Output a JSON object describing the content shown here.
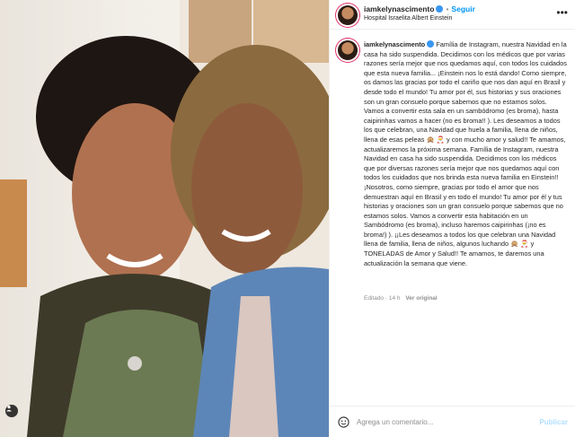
{
  "post": {
    "username": "iamkelynascimento",
    "follow_label": "Seguir",
    "separator": "•",
    "location": "Hospital Israelita Albert Einstein",
    "caption": "Família de Instagram, nuestra Navidad en la casa ha sido suspendida. Decidimos con los médicos que por varias razones sería mejor que nos quedamos aquí, con todos los cuidados que esta nueva familia... ¡Einstein nos lo está dando! Como siempre, os damos las gracias por todo el cariño que nos dan aquí en Brasil y desde todo el mundo! Tu amor por él, sus historias y sus oraciones son un gran consuelo porque sabemos que no estamos solos. Vamos a convertir esta sala en un sambódromo (es broma), hasta caipirinhas vamos a hacer (no es broma!! ). Les deseamos a todos los que celebran, una Navidad que huela a familia, llena de niños, llena de esas peleas 🙊 🎅 y con mucho amor y salud!! Te amamos, actualizaremos la próxima semana. Família de Instagram, nuestra Navidad en casa ha sido suspendida. Decidimos con los médicos que por diversas razones sería mejor que nos quedamos aquí con todos los cuidados que nos brinda esta nueva familia en Einstein!! ¡Nosotros, como siempre, gracias por todo el amor que nos demuestran aquí en Brasil y en todo el mundo! Tu amor por él y tus historias y oraciones son un gran consuelo porque sabemos que no estamos solos. Vamos a convertir esta habitación en un Sambódromo (es broma), incluso haremos caipirinhas (¡no es broma!) ). ¡¡Les deseamos a todos los que celebran una Navidad llena de familia, llena de niños, algunos luchando 🙊 🎅 y TONELADAS de Amor y Salud!! Te amamos, te daremos una actualización la semana que viene.",
    "edited_label": "Editado",
    "time": "14 h",
    "meta_separator": "·",
    "translate_label": "Ver original"
  },
  "comment_box": {
    "placeholder": "Agrega un comentario...",
    "publish_label": "Publicar"
  },
  "colors": {
    "accent": "#0095f6",
    "verified": "#3897f0",
    "publish_disabled": "#b2dffc",
    "secondary_text": "#8e8e8e"
  },
  "icons": [
    "verified-badge-icon",
    "more-options-icon",
    "emoji-icon",
    "user-tag-icon"
  ]
}
